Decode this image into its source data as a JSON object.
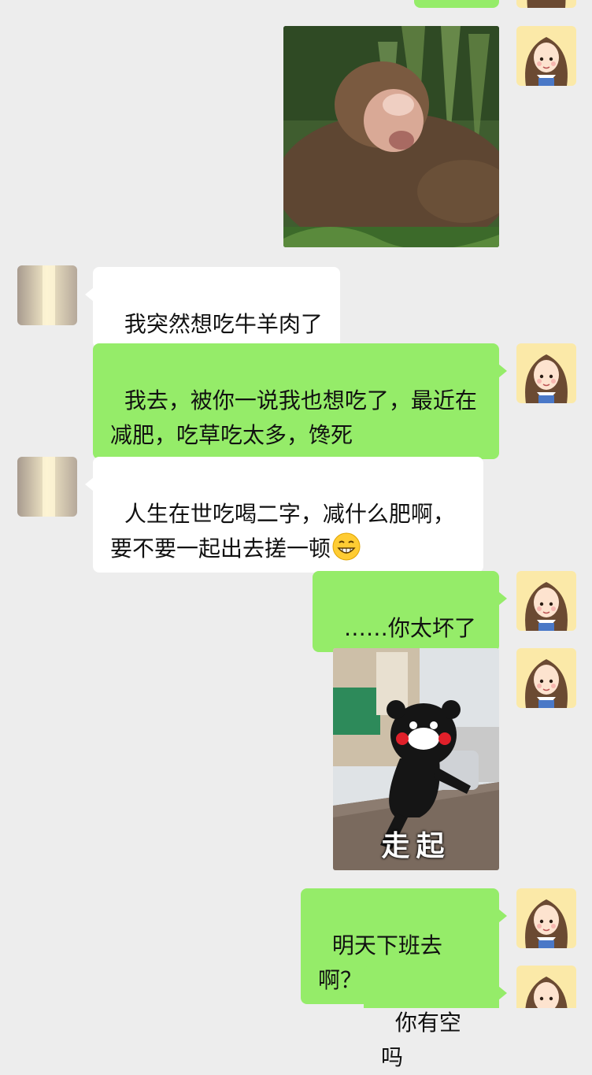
{
  "messages": [
    {
      "sender": "me",
      "type": "sticker",
      "sticker": "monkey-eating-sticker"
    },
    {
      "sender": "them",
      "type": "text",
      "text": "我突然想吃牛羊肉了"
    },
    {
      "sender": "me",
      "type": "text",
      "text": "我去，被你一说我也想吃了，最近在减肥，吃草吃太多，馋死"
    },
    {
      "sender": "them",
      "type": "text",
      "text": "人生在世吃喝二字，减什么肥啊，要不要一起出去搓一顿",
      "emoji": "grinning-face-emoji"
    },
    {
      "sender": "me",
      "type": "text",
      "text": "……你太坏了"
    },
    {
      "sender": "me",
      "type": "sticker",
      "sticker": "kumamon-sticker",
      "caption": "走起"
    },
    {
      "sender": "me",
      "type": "text",
      "text": "明天下班去啊？"
    },
    {
      "sender": "me",
      "type": "text",
      "text": "你有空吗"
    }
  ],
  "colors": {
    "background": "#ededed",
    "my_bubble": "#95ec69",
    "their_bubble": "#ffffff"
  },
  "avatars": {
    "me": "cartoon-girl-avatar",
    "them": "blurred-photo-avatar"
  }
}
